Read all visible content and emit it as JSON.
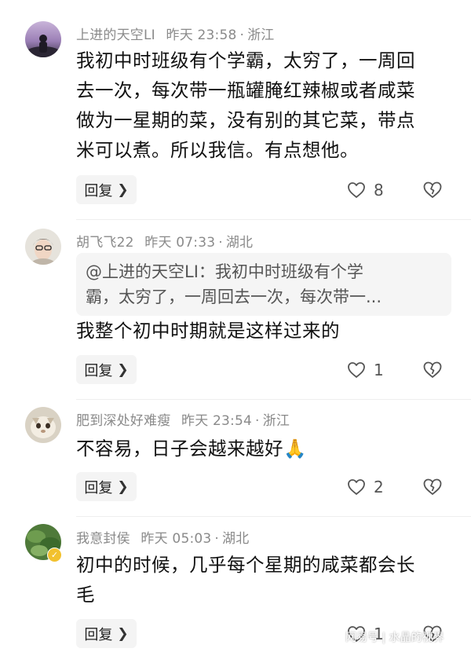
{
  "comments": [
    {
      "username": "上进的天空LI",
      "time": "昨天 23:58",
      "location": "浙江",
      "lines": [
        "我初中时班级有个学霸，太穷了，一周回",
        "去一次，每次带一瓶罐腌红辣椒或者咸菜",
        "做为一星期的菜，没有别的其它菜，带点",
        "米可以煮。所以我信。有点想他。"
      ],
      "reply_label": "回复",
      "likes": "8"
    },
    {
      "username": "胡飞飞22",
      "time": "昨天 07:33",
      "location": "湖北",
      "quote_lines": [
        "@上进的天空LI：我初中时班级有个学",
        "霸，太穷了，一周回去一次，每次带一..."
      ],
      "lines": [
        "我整个初中时期就是这样过来的"
      ],
      "reply_label": "回复",
      "likes": "1"
    },
    {
      "username": "肥到深处好难瘦",
      "time": "昨天 23:54",
      "location": "浙江",
      "lines": [
        "不容易，日子会越来越好"
      ],
      "emoji": "🙏",
      "reply_label": "回复",
      "likes": "2"
    },
    {
      "username": "我意封侯",
      "time": "昨天 05:03",
      "location": "湖北",
      "lines": [
        "初中的时候，几乎每个星期的咸菜都会长",
        "毛"
      ],
      "reply_label": "回复",
      "likes": "1"
    }
  ],
  "icons": {
    "like": "heart-outline-icon",
    "dislike": "broken-heart-icon",
    "reply_chevron": "chevron-right-icon"
  },
  "colors": {
    "meta": "#8a8a8a",
    "button_bg": "#f4f4f4",
    "quote_bg": "#f5f5f5"
  },
  "watermark": "网易号 | 水晶的视界"
}
